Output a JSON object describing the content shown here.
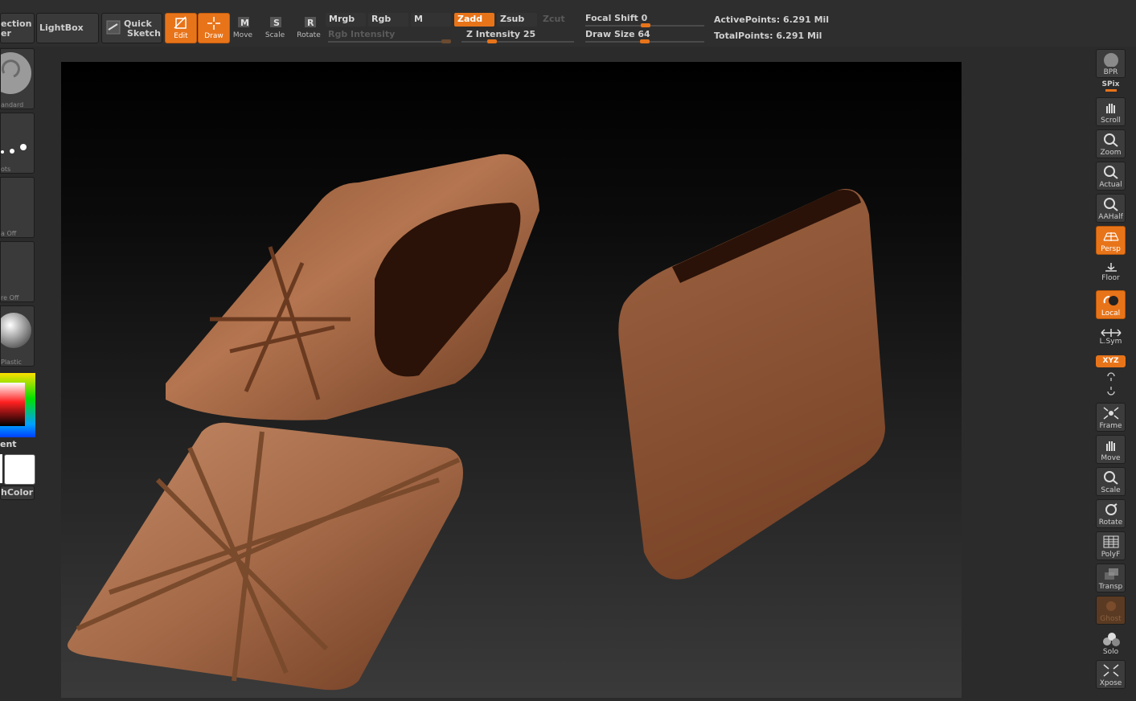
{
  "toolbar": {
    "projection_label": "ection\ner",
    "lightbox_label": "LightBox",
    "quick_sketch_line1": "Quick",
    "quick_sketch_line2": "Sketch",
    "edit_label": "Edit",
    "draw_label": "Draw",
    "move_label": "Move",
    "scale_label": "Scale",
    "rotate_label": "Rotate",
    "move_key": "M",
    "scale_key": "S",
    "rotate_key": "R",
    "mrgb_label": "Mrgb",
    "rgb_label": "Rgb",
    "m_label": "M",
    "zadd_label": "Zadd",
    "zsub_label": "Zsub",
    "zcut_label": "Zcut",
    "rgb_intensity_label": "Rgb  Intensity",
    "z_intensity_label": "Z  Intensity",
    "z_intensity_value": "25",
    "z_intensity_fraction": 0.25,
    "rgb_intensity_fraction": 1.0,
    "focal_shift_label": "Focal  Shift",
    "focal_shift_value": "0",
    "draw_size_label": "Draw  Size",
    "draw_size_value": "64",
    "active_points_label": "ActivePoints:",
    "active_points_value": "6.291  Mil",
    "total_points_label": "TotalPoints:",
    "total_points_value": "6.291  Mil"
  },
  "left_panel": {
    "brush_caption": "andard",
    "stroke_caption": "ots",
    "alpha_caption": "a  Off",
    "texture_caption": "re  Off",
    "material_caption": "Plastic",
    "gradient_label": "ent",
    "switch_color_label": "hColor"
  },
  "right_panel": {
    "bpr_label": "BPR",
    "spix_label": "SPix",
    "scroll_label": "Scroll",
    "zoom_label": "Zoom",
    "actual_label": "Actual",
    "aahalf_label": "AAHalf",
    "persp_label": "Persp",
    "floor_label": "Floor",
    "local_label": "Local",
    "lsym_label": "L.Sym",
    "xyz_label": "XYZ",
    "frame_label": "Frame",
    "move_label": "Move",
    "scale_label": "Scale",
    "rotate_label": "Rotate",
    "polyf_label": "PolyF",
    "transp_label": "Transp",
    "ghost_label": "Ghost",
    "solo_label": "Solo",
    "xpose_label": "Xpose"
  },
  "colors": {
    "accent": "#e8741a",
    "panel": "#2b2b2b",
    "button": "#3a3a3a",
    "copper": "#a0603a"
  }
}
